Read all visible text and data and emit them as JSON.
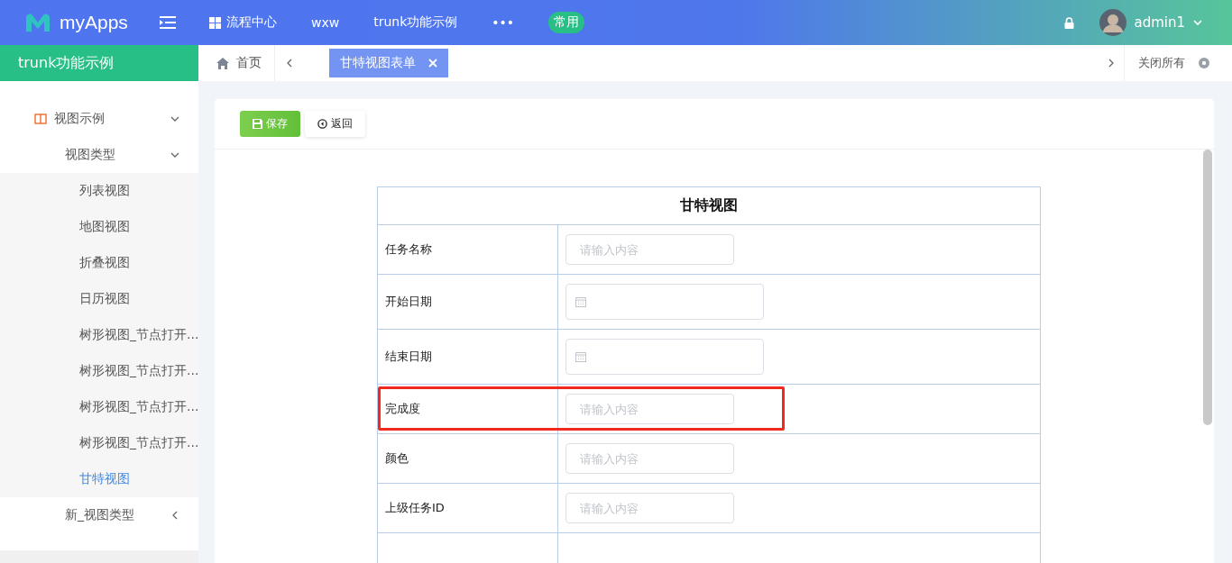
{
  "topbar": {
    "logo": "myApps",
    "nav": [
      {
        "label": "流程中心",
        "kind": "grid"
      },
      {
        "label": "wxw",
        "kind": "plain"
      },
      {
        "label": "trunk功能示例",
        "kind": "plain"
      },
      {
        "label": "•••",
        "kind": "plain"
      }
    ],
    "badge": "常用",
    "user": "admin1"
  },
  "sidebar": {
    "title": "trunk功能示例",
    "items": [
      {
        "label": "视图示例",
        "expanded": true,
        "selected": false,
        "children": [
          {
            "label": "视图类型",
            "expanded": true,
            "selected": false,
            "children": [
              {
                "label": "列表视图",
                "selected": false
              },
              {
                "label": "地图视图",
                "selected": false
              },
              {
                "label": "折叠视图",
                "selected": false
              },
              {
                "label": "日历视图",
                "selected": false
              },
              {
                "label": "树形视图_节点打开...",
                "selected": false
              },
              {
                "label": "树形视图_节点打开...",
                "selected": false
              },
              {
                "label": "树形视图_节点打开...",
                "selected": false
              },
              {
                "label": "树形视图_节点打开...",
                "selected": false
              },
              {
                "label": "甘特视图",
                "selected": true
              }
            ]
          },
          {
            "label": "新_视图类型",
            "expanded": false,
            "selected": false
          }
        ]
      }
    ]
  },
  "tabbar": {
    "home": "首页",
    "tabs": [
      {
        "label": "甘特视图表单",
        "selected": true
      }
    ],
    "close_all": "关闭所有"
  },
  "toolbar": {
    "buttons": [
      {
        "label": "保存",
        "kind": "primary"
      },
      {
        "label": "返回",
        "kind": "default"
      }
    ]
  },
  "form": {
    "title": "甘特视图",
    "rows": [
      {
        "label": "任务名称",
        "kind": "text",
        "placeholder": "请输入内容",
        "highlighted": false
      },
      {
        "label": "开始日期",
        "kind": "date",
        "highlighted": false
      },
      {
        "label": "结束日期",
        "kind": "date",
        "highlighted": false
      },
      {
        "label": "完成度",
        "kind": "text",
        "placeholder": "请输入内容",
        "highlighted": true
      },
      {
        "label": "颜色",
        "kind": "text",
        "placeholder": "请输入内容",
        "highlighted": false
      },
      {
        "label": "上级任务ID",
        "kind": "text",
        "placeholder": "请输入内容",
        "highlighted": false
      }
    ]
  }
}
